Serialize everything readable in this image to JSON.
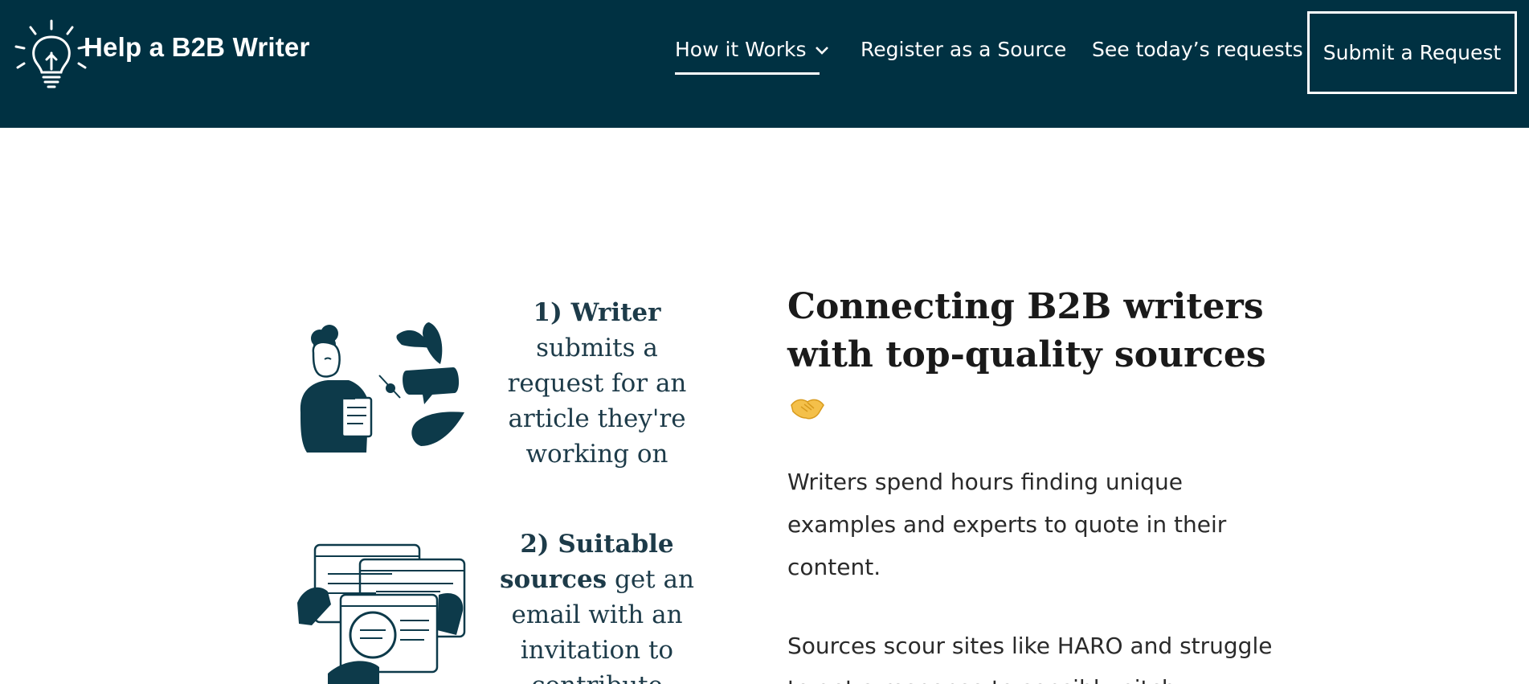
{
  "header": {
    "brand": "Help a B2B Writer",
    "logo_icon": "lightbulb-icon",
    "nav": {
      "how_it_works": "How it Works",
      "register": "Register as a Source",
      "requests": "See today’s requests"
    },
    "submit_label": "Submit a Request"
  },
  "steps": [
    {
      "number": "1)",
      "bold": "Writer",
      "text": "submits a request for an article they're working on"
    },
    {
      "number": "2)",
      "bold": "Suitable sources",
      "text": "get an email with an invitation to contribute"
    }
  ],
  "main": {
    "heading": "Connecting B2B writers with top-quality sources",
    "emoji": "handshake-icon",
    "paragraph1": "Writers spend hours finding unique examples and experts to quote in their content.",
    "paragraph2": "Sources scour sites like HARO and struggle to get a response to sensibly pitch."
  },
  "colors": {
    "header_bg": "#003142",
    "accent": "#1d3b49",
    "white": "#ffffff"
  }
}
